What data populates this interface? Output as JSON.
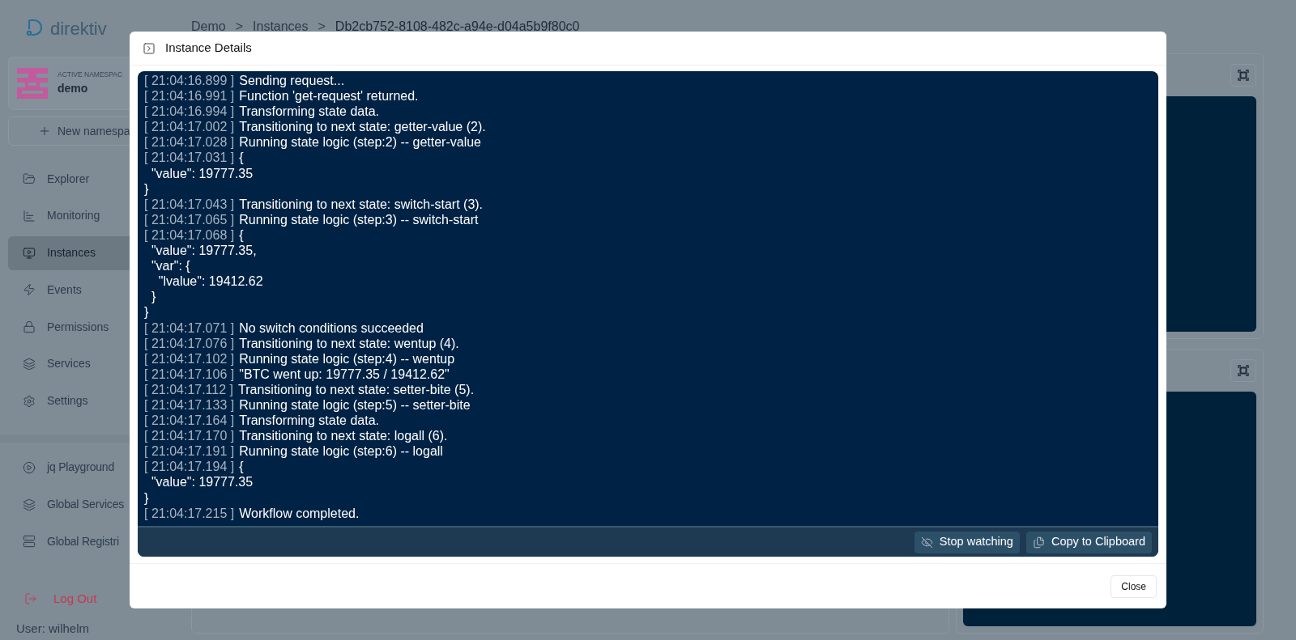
{
  "app": {
    "logo_text": "direktiv"
  },
  "breadcrumbs": [
    {
      "label": "Demo",
      "separator": ">"
    },
    {
      "label": "Instances",
      "separator": ">"
    },
    {
      "label": "Db2cb752-8108-482c-a94e-d04a5b9f80c0"
    }
  ],
  "namespace": {
    "caption": "ACTIVE NAMESPAC",
    "name": "demo"
  },
  "new_namespace_button": {
    "label": "New namespa"
  },
  "nav": [
    {
      "label": "Explorer",
      "selected": false
    },
    {
      "label": "Monitoring",
      "selected": false
    },
    {
      "label": "Instances",
      "selected": true
    },
    {
      "label": "Events",
      "selected": false
    },
    {
      "label": "Permissions",
      "selected": false
    },
    {
      "label": "Services",
      "selected": false
    },
    {
      "label": "Settings",
      "selected": false
    }
  ],
  "tools_nav": [
    {
      "label": "jq Playground"
    },
    {
      "label": "Global Services"
    },
    {
      "label": "Global Registri"
    }
  ],
  "logout": {
    "label": "Log Out"
  },
  "user": {
    "label": "User: wilhelm"
  },
  "dialog": {
    "title": "Instance Details",
    "log_lines": [
      {
        "kind": "entry",
        "time": "[ 21:04:16.899 ]",
        "message": "Sending request..."
      },
      {
        "kind": "entry",
        "time": "[ 21:04:16.991 ]",
        "message": "Function 'get-request' returned."
      },
      {
        "kind": "entry",
        "time": "[ 21:04:16.994 ]",
        "message": "Transforming state data."
      },
      {
        "kind": "entry",
        "time": "[ 21:04:17.002 ]",
        "message": "Transitioning to next state: getter-value (2)."
      },
      {
        "kind": "entry",
        "time": "[ 21:04:17.028 ]",
        "message": "Running state logic (step:2) -- getter-value"
      },
      {
        "kind": "entry",
        "time": "[ 21:04:17.031 ]",
        "message": "{"
      },
      {
        "kind": "continuation",
        "text": "  \"value\": 19777.35"
      },
      {
        "kind": "continuation",
        "text": "}"
      },
      {
        "kind": "entry",
        "time": "[ 21:04:17.043 ]",
        "message": "Transitioning to next state: switch-start (3)."
      },
      {
        "kind": "entry",
        "time": "[ 21:04:17.065 ]",
        "message": "Running state logic (step:3) -- switch-start"
      },
      {
        "kind": "entry",
        "time": "[ 21:04:17.068 ]",
        "message": "{"
      },
      {
        "kind": "continuation",
        "text": "  \"value\": 19777.35,"
      },
      {
        "kind": "continuation",
        "text": "  \"var\": {"
      },
      {
        "kind": "continuation",
        "text": "    \"lvalue\": 19412.62"
      },
      {
        "kind": "continuation",
        "text": "  }"
      },
      {
        "kind": "continuation",
        "text": "}"
      },
      {
        "kind": "entry",
        "time": "[ 21:04:17.071 ]",
        "message": "No switch conditions succeeded"
      },
      {
        "kind": "entry",
        "time": "[ 21:04:17.076 ]",
        "message": "Transitioning to next state: wentup (4)."
      },
      {
        "kind": "entry",
        "time": "[ 21:04:17.102 ]",
        "message": "Running state logic (step:4) -- wentup"
      },
      {
        "kind": "entry",
        "time": "[ 21:04:17.106 ]",
        "message": "\"BTC went up: 19777.35 / 19412.62\""
      },
      {
        "kind": "entry",
        "time": "[ 21:04:17.112 ]",
        "message": "Transitioning to next state: setter-bite (5)."
      },
      {
        "kind": "entry",
        "time": "[ 21:04:17.133 ]",
        "message": "Running state logic (step:5) -- setter-bite"
      },
      {
        "kind": "entry",
        "time": "[ 21:04:17.164 ]",
        "message": "Transforming state data."
      },
      {
        "kind": "entry",
        "time": "[ 21:04:17.170 ]",
        "message": "Transitioning to next state: logall (6)."
      },
      {
        "kind": "entry",
        "time": "[ 21:04:17.191 ]",
        "message": "Running state logic (step:6) -- logall"
      },
      {
        "kind": "entry",
        "time": "[ 21:04:17.194 ]",
        "message": "{"
      },
      {
        "kind": "continuation",
        "text": "  \"value\": 19777.35"
      },
      {
        "kind": "continuation",
        "text": "}"
      },
      {
        "kind": "entry",
        "time": "[ 21:04:17.215 ]",
        "message": "Workflow completed."
      }
    ],
    "actions": [
      {
        "kind": "stop_watching",
        "label": "Stop watching"
      },
      {
        "kind": "copy",
        "label": "Copy to Clipboard"
      }
    ],
    "close_button": {
      "label": "Close"
    }
  }
}
